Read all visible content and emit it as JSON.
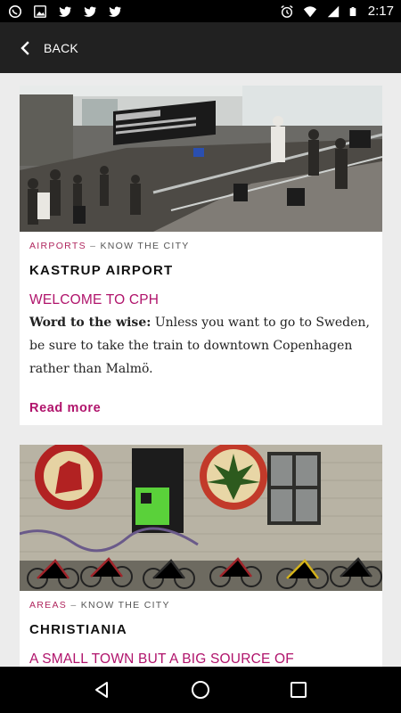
{
  "status_bar": {
    "time": "2:17",
    "left_icons": [
      "whatsapp-icon",
      "image-icon",
      "twitter-icon",
      "twitter-icon",
      "twitter-icon"
    ],
    "right_icons": [
      "alarm-icon",
      "wifi-icon",
      "signal-icon",
      "battery-icon"
    ]
  },
  "app_bar": {
    "back_label": "BACK"
  },
  "cards": [
    {
      "image": "airport-departures-photo",
      "category": "AIRPORTS",
      "separator": "–",
      "section": "KNOW THE CITY",
      "title": "KASTRUP AIRPORT",
      "subtitle": "WELCOME TO CPH",
      "body_bold": "Word to the wise:",
      "body_text": " Unless you want to go to Sweden, be sure to take the train to downtown Copenhagen rather than Malmö.",
      "read_more": "Read more"
    },
    {
      "image": "christiania-mural-photo",
      "category": "AREAS",
      "separator": "–",
      "section": "KNOW THE CITY",
      "title": "CHRISTIANIA",
      "subtitle": "A SMALL TOWN BUT A BIG SOURCE OF"
    }
  ],
  "nav_bar": {
    "buttons": [
      "back-triangle-icon",
      "home-circle-icon",
      "recents-square-icon"
    ]
  },
  "colors": {
    "accent": "#b0136b",
    "app_bar": "#212121",
    "background": "#ececec"
  }
}
